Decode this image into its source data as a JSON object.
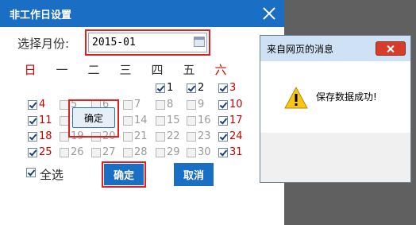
{
  "main_dialog": {
    "title": "非工作日设置",
    "month_label": "选择月份:",
    "month_value": "2015-01",
    "weekday_headers": [
      "日",
      "一",
      "二",
      "三",
      "四",
      "五",
      "六"
    ],
    "days": [
      {
        "day": "1",
        "checked": true,
        "enabled": true,
        "weekend": false
      },
      {
        "day": "2",
        "checked": true,
        "enabled": true,
        "weekend": false
      },
      {
        "day": "3",
        "checked": true,
        "enabled": true,
        "weekend": true
      },
      {
        "day": "4",
        "checked": true,
        "enabled": true,
        "weekend": true
      },
      {
        "day": "5",
        "checked": false,
        "enabled": false,
        "weekend": false
      },
      {
        "day": "6",
        "checked": false,
        "enabled": false,
        "weekend": false
      },
      {
        "day": "7",
        "checked": false,
        "enabled": false,
        "weekend": false
      },
      {
        "day": "8",
        "checked": false,
        "enabled": false,
        "weekend": false
      },
      {
        "day": "9",
        "checked": false,
        "enabled": false,
        "weekend": false
      },
      {
        "day": "10",
        "checked": true,
        "enabled": true,
        "weekend": true
      },
      {
        "day": "11",
        "checked": true,
        "enabled": true,
        "weekend": true
      },
      {
        "day": "12",
        "checked": false,
        "enabled": false,
        "weekend": false
      },
      {
        "day": "13",
        "checked": false,
        "enabled": false,
        "weekend": false
      },
      {
        "day": "14",
        "checked": false,
        "enabled": false,
        "weekend": false
      },
      {
        "day": "15",
        "checked": false,
        "enabled": false,
        "weekend": false
      },
      {
        "day": "16",
        "checked": false,
        "enabled": false,
        "weekend": false
      },
      {
        "day": "17",
        "checked": true,
        "enabled": true,
        "weekend": true
      },
      {
        "day": "18",
        "checked": true,
        "enabled": true,
        "weekend": true
      },
      {
        "day": "19",
        "checked": false,
        "enabled": false,
        "weekend": false
      },
      {
        "day": "20",
        "checked": false,
        "enabled": false,
        "weekend": false
      },
      {
        "day": "21",
        "checked": false,
        "enabled": false,
        "weekend": false
      },
      {
        "day": "22",
        "checked": false,
        "enabled": false,
        "weekend": false
      },
      {
        "day": "23",
        "checked": false,
        "enabled": false,
        "weekend": false
      },
      {
        "day": "24",
        "checked": true,
        "enabled": true,
        "weekend": true
      },
      {
        "day": "25",
        "checked": true,
        "enabled": true,
        "weekend": true
      },
      {
        "day": "26",
        "checked": false,
        "enabled": false,
        "weekend": false
      },
      {
        "day": "27",
        "checked": false,
        "enabled": false,
        "weekend": false
      },
      {
        "day": "28",
        "checked": false,
        "enabled": false,
        "weekend": false
      },
      {
        "day": "29",
        "checked": false,
        "enabled": false,
        "weekend": false
      },
      {
        "day": "30",
        "checked": false,
        "enabled": false,
        "weekend": false
      },
      {
        "day": "31",
        "checked": true,
        "enabled": true,
        "weekend": true
      }
    ],
    "select_all_label": "全选",
    "select_all_checked": true,
    "confirm_label": "确定",
    "cancel_label": "取消"
  },
  "message_box": {
    "title": "来自网页的消息",
    "message": "保存数据成功!",
    "ok_label": "确定"
  },
  "colors": {
    "brand_blue": "#1a6fc4",
    "weekend_red": "#cc0000",
    "highlight_red": "#e02020",
    "backdrop": "#606060"
  },
  "icons": {
    "close": "close-icon",
    "calendar": "calendar-icon",
    "warning": "warning-icon"
  }
}
